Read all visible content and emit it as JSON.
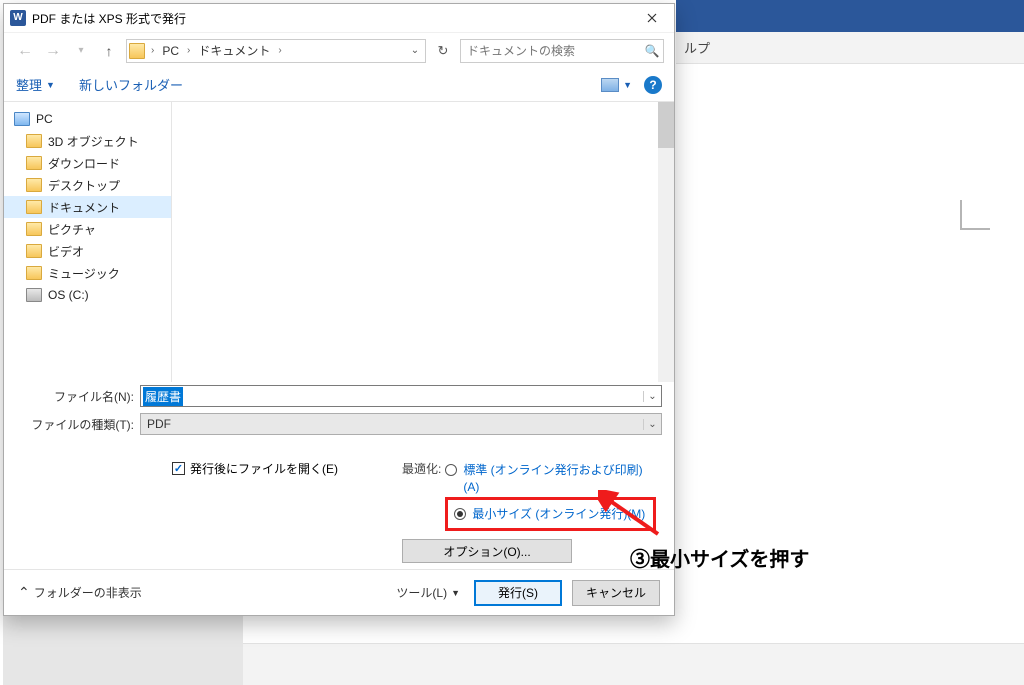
{
  "background": {
    "help_label": "ルプ"
  },
  "dialog": {
    "title": "PDF または XPS 形式で発行",
    "nav": {
      "breadcrumb": [
        "PC",
        "ドキュメント"
      ],
      "search_placeholder": "ドキュメントの検索"
    },
    "toolbar": {
      "organize": "整理",
      "new_folder": "新しいフォルダー"
    },
    "tree": [
      {
        "label": "PC",
        "type": "pc"
      },
      {
        "label": "3D オブジェクト"
      },
      {
        "label": "ダウンロード"
      },
      {
        "label": "デスクトップ"
      },
      {
        "label": "ドキュメント",
        "selected": true
      },
      {
        "label": "ピクチャ"
      },
      {
        "label": "ビデオ"
      },
      {
        "label": "ミュージック"
      },
      {
        "label": "OS (C:)"
      }
    ],
    "filename_label": "ファイル名(N):",
    "filename_value": "履歴書",
    "filetype_label": "ファイルの種類(T):",
    "filetype_value": "PDF",
    "open_after_label": "発行後にファイルを開く(E)",
    "open_after_checked": true,
    "optimize_label": "最適化:",
    "opt_standard": "標準 (オンライン発行および印刷)(A)",
    "opt_minimum": "最小サイズ (オンライン発行)(M)",
    "options_button": "オプション(O)...",
    "footer": {
      "hide_folders": "フォルダーの非表示",
      "tools": "ツール(L)",
      "publish": "発行(S)",
      "cancel": "キャンセル"
    }
  },
  "annotation": {
    "text": "③最小サイズを押す"
  }
}
